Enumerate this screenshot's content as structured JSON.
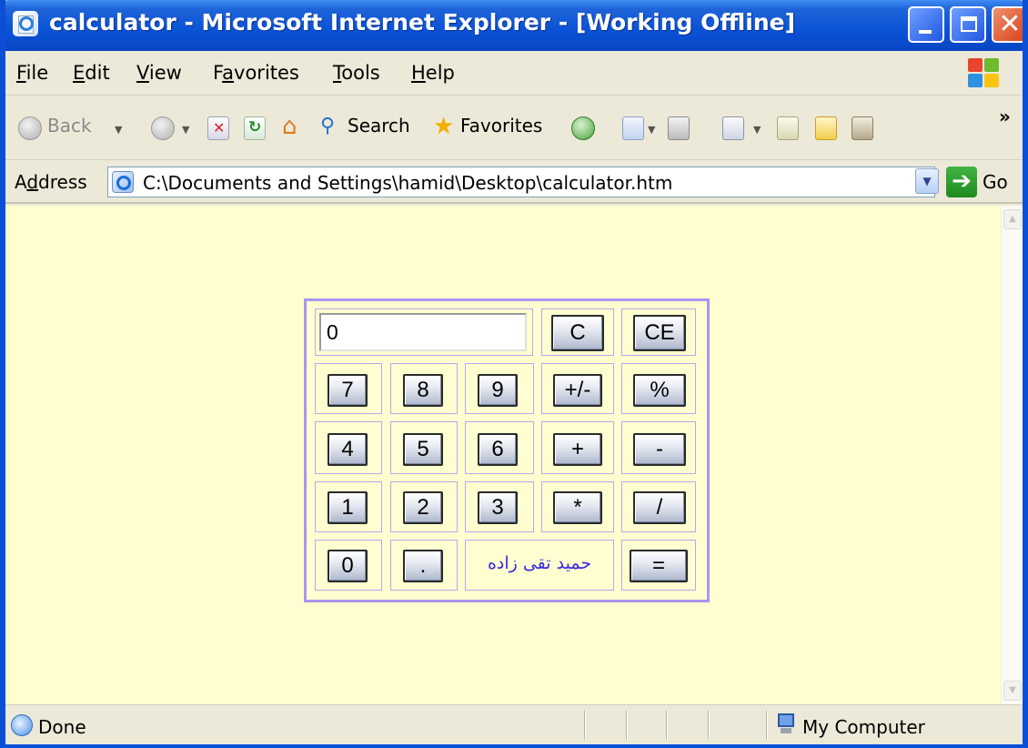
{
  "window": {
    "title": "calculator - Microsoft Internet Explorer - [Working Offline]",
    "controls": {
      "minimize": "–",
      "maximize": "□",
      "close": "✕"
    }
  },
  "menu": [
    {
      "label": "File",
      "accel": "F",
      "rest": "ile"
    },
    {
      "label": "Edit",
      "accel": "E",
      "rest": "dit"
    },
    {
      "label": "View",
      "accel": "V",
      "rest": "iew"
    },
    {
      "label": "Favorites",
      "pre": "F",
      "accel": "a",
      "rest": "vorites"
    },
    {
      "label": "Tools",
      "accel": "T",
      "rest": "ools"
    },
    {
      "label": "Help",
      "accel": "H",
      "rest": "elp"
    }
  ],
  "toolbar": {
    "back_label": "Back",
    "search_label": "Search",
    "favorites_label": "Favorites",
    "more_label": "»",
    "icons": [
      "back-arrow-icon",
      "forward-arrow-icon",
      "stop-icon",
      "refresh-icon",
      "home-icon",
      "search-icon",
      "favorites-star-icon",
      "history-icon",
      "mail-icon",
      "print-icon",
      "edit-icon",
      "discuss-icon",
      "messenger-icon",
      "research-icon"
    ]
  },
  "address": {
    "label": "Address",
    "label_accel": "d",
    "url": "C:\\Documents and Settings\\hamid\\Desktop\\calculator.htm",
    "go_label": "Go"
  },
  "calculator": {
    "display": "0",
    "row1": [
      "C",
      "CE"
    ],
    "row2": [
      "7",
      "8",
      "9",
      "+/-",
      "%"
    ],
    "row3": [
      "4",
      "5",
      "6",
      "+",
      "-"
    ],
    "row4": [
      "1",
      "2",
      "3",
      "*",
      "/"
    ],
    "row5": [
      "0",
      ".",
      "="
    ],
    "signature": "حمید تقی زاده"
  },
  "status": {
    "text": "Done",
    "zone": "My Computer"
  },
  "colors": {
    "titlebar": "#0a52d6",
    "page_background": "#fffed0",
    "calc_border": "#a896f0",
    "signature": "#3b2ae0"
  }
}
